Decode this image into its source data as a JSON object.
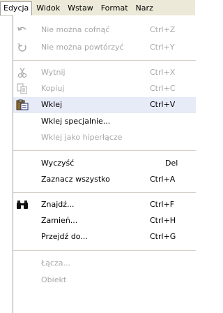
{
  "menubar": {
    "items": [
      "Edycja",
      "Widok",
      "Wstaw",
      "Format",
      "Narz"
    ]
  },
  "menu": {
    "undo": {
      "label": "Nie można cofnąć",
      "shortcut": "Ctrl+Z",
      "icon": "undo-arrow-icon"
    },
    "redo": {
      "label": "Nie można powtórzyć",
      "shortcut": "Ctrl+Y",
      "icon": "redo-arrow-icon"
    },
    "cut": {
      "label": "Wytnij",
      "shortcut": "Ctrl+X",
      "icon": "scissors-icon"
    },
    "copy": {
      "label": "Kopiuj",
      "shortcut": "Ctrl+C",
      "icon": "copy-icon"
    },
    "paste": {
      "label": "Wklej",
      "shortcut": "Ctrl+V",
      "icon": "clipboard-icon"
    },
    "paste_special": {
      "label": "Wklej specjalnie..."
    },
    "paste_hyperlink": {
      "label": "Wklej jako hiperłącze"
    },
    "clear": {
      "label": "Wyczyść",
      "shortcut": "Del"
    },
    "select_all": {
      "label": "Zaznacz wszystko",
      "shortcut": "Ctrl+A"
    },
    "find": {
      "label": "Znajdź...",
      "shortcut": "Ctrl+F",
      "icon": "binoculars-icon"
    },
    "replace": {
      "label": "Zamień...",
      "shortcut": "Ctrl+H"
    },
    "goto": {
      "label": "Przejdź do...",
      "shortcut": "Ctrl+G"
    },
    "links": {
      "label": "Łącza..."
    },
    "object": {
      "label": "Obiekt"
    }
  },
  "colors": {
    "disabled": "#a8a8a8",
    "menubar_bg": "#ece9d8",
    "selected": "#e7eaf7"
  }
}
